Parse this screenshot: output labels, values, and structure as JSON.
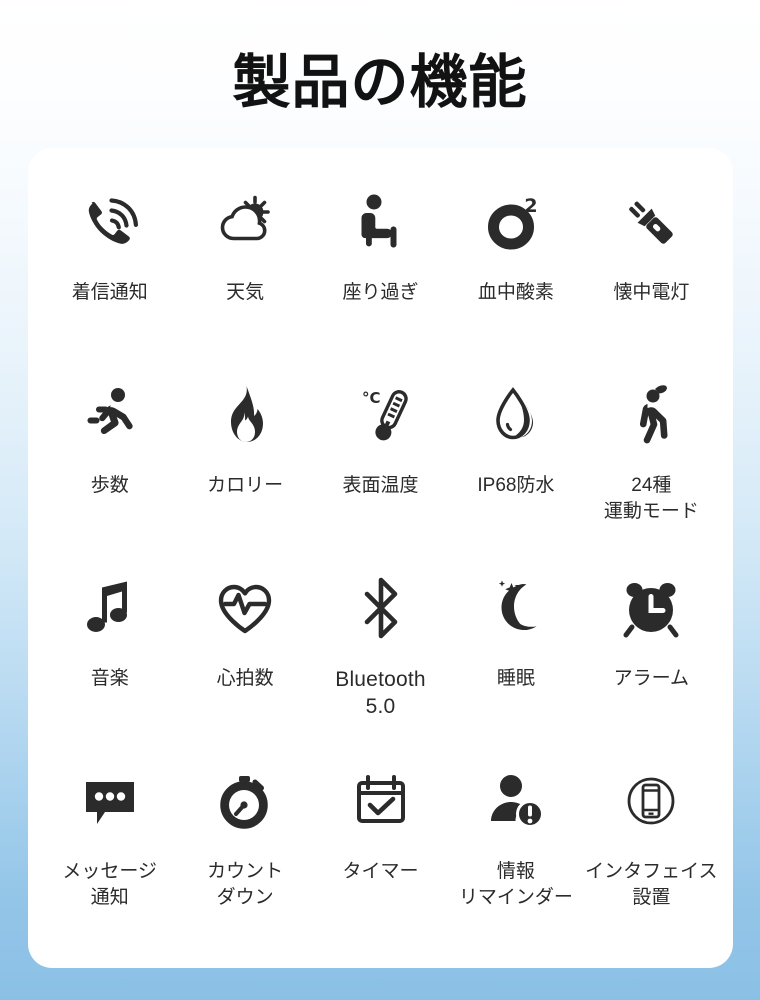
{
  "page": {
    "title": "製品の機能",
    "background_top_color": "#ffffff",
    "background_bottom_color": "#8bc0e5",
    "card_color": "#ffffff",
    "icon_color": "#2b2b2b",
    "label_color": "#2b2b2b"
  },
  "features": {
    "rows": [
      {
        "cells": [
          {
            "icon": "incoming-call-icon",
            "label": "着信通知"
          },
          {
            "icon": "weather-cloud-sun-icon",
            "label": "天気"
          },
          {
            "icon": "sedentary-sitting-person-icon",
            "label": "座り過ぎ"
          },
          {
            "icon": "blood-oxygen-o2-icon",
            "label": "血中酸素"
          },
          {
            "icon": "flashlight-icon",
            "label": "懐中電灯"
          }
        ]
      },
      {
        "cells": [
          {
            "icon": "running-person-steps-icon",
            "label": "歩数"
          },
          {
            "icon": "flame-calories-icon",
            "label": "カロリー"
          },
          {
            "icon": "thermometer-celsius-icon",
            "label": "表面温度"
          },
          {
            "icon": "water-drop-icon",
            "label": "IP68防水"
          },
          {
            "icon": "stretching-person-icon",
            "label": "24種\n運動モード"
          }
        ]
      },
      {
        "cells": [
          {
            "icon": "music-note-icon",
            "label": "音楽"
          },
          {
            "icon": "heart-rate-pulse-icon",
            "label": "心拍数"
          },
          {
            "icon": "bluetooth-icon",
            "label": "Bluetooth\n5.0"
          },
          {
            "icon": "moon-star-sleep-icon",
            "label": "睡眠"
          },
          {
            "icon": "alarm-clock-icon",
            "label": "アラーム"
          }
        ]
      },
      {
        "cells": [
          {
            "icon": "message-bubble-icon",
            "label": "メッセージ\n通知"
          },
          {
            "icon": "stopwatch-countdown-icon",
            "label": "カウント\nダウン"
          },
          {
            "icon": "calendar-check-timer-icon",
            "label": "タイマー"
          },
          {
            "icon": "person-alert-reminder-icon",
            "label": "情報\nリマインダー"
          },
          {
            "icon": "phone-interface-icon",
            "label": "インタフェイス\n設置"
          }
        ]
      }
    ]
  }
}
